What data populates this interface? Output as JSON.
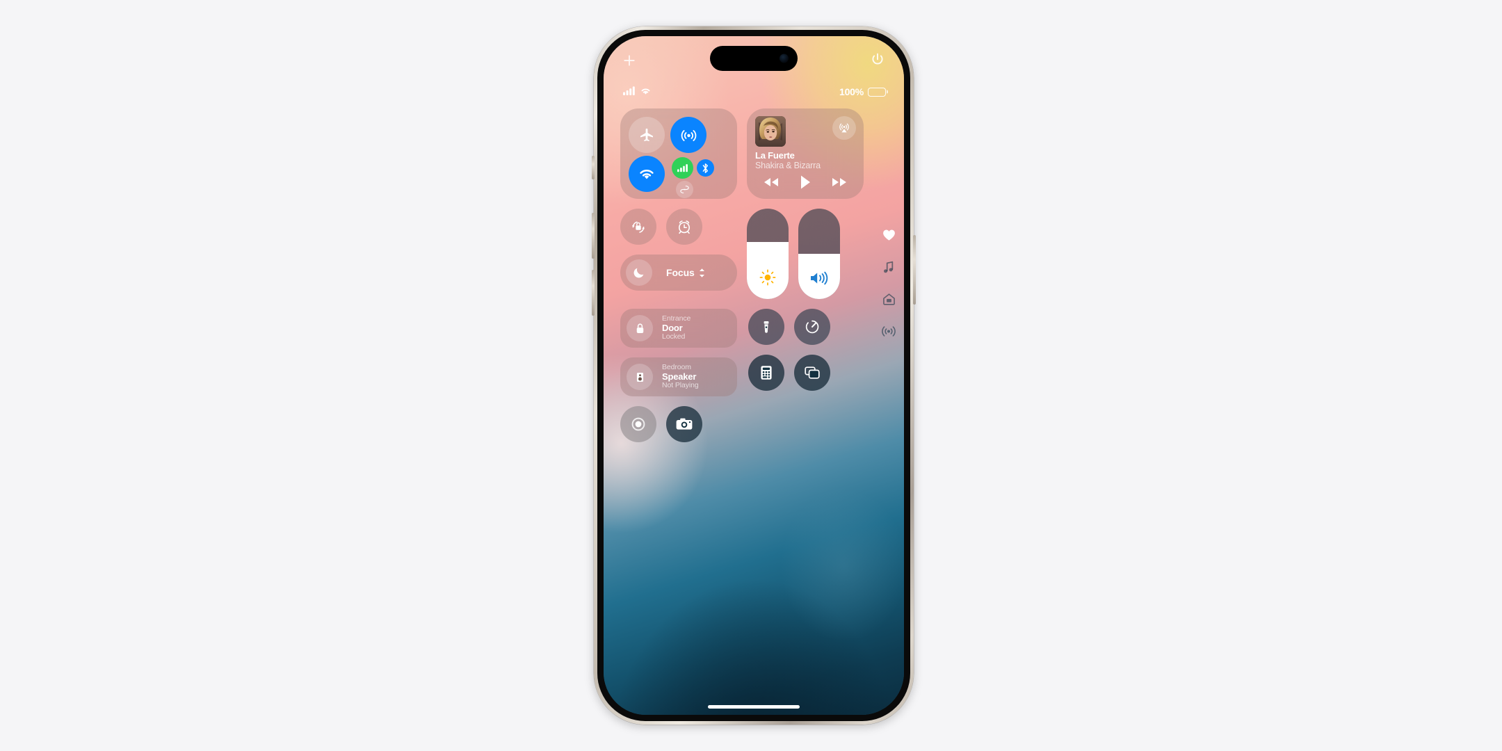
{
  "device": {
    "name": "iPhone",
    "frame": "titanium"
  },
  "statusbar": {
    "signal_icon": "cellular-bars-icon",
    "wifi_icon": "wifi-icon",
    "battery_percent": "100%",
    "battery_icon": "battery-full-icon"
  },
  "top_controls": {
    "add_label": "+",
    "add_name": "plus-icon",
    "power_name": "power-icon"
  },
  "connectivity": {
    "airplane": {
      "label": "Airplane Mode",
      "state": "off",
      "color": "#ffffff38"
    },
    "airdrop": {
      "label": "AirDrop",
      "state": "on",
      "color": "#0a84ff"
    },
    "wifi": {
      "label": "Wi-Fi",
      "state": "on",
      "color": "#0a84ff"
    },
    "cellular": {
      "label": "Cellular Data",
      "state": "on",
      "color": "#30d158"
    },
    "bluetooth": {
      "label": "Bluetooth",
      "state": "on",
      "color": "#0a84ff"
    },
    "hotspot": {
      "label": "Personal Hotspot",
      "state": "off",
      "color": "#ffffff33"
    }
  },
  "now_playing": {
    "title": "La Fuerte",
    "artist": "Shakira & Bizarra",
    "airplay_icon": "airplay-audio-icon",
    "rewind_icon": "rewind-icon",
    "play_icon": "play-icon",
    "forward_icon": "fast-forward-icon"
  },
  "quick_toggles": {
    "rotation_lock": {
      "label": "Rotation Lock",
      "icon": "rotation-lock-icon"
    },
    "alarm": {
      "label": "Alarm",
      "icon": "alarm-clock-icon"
    }
  },
  "focus": {
    "label": "Focus",
    "moon_icon": "moon-icon",
    "chevron_icon": "chevron-up-down-icon"
  },
  "home_accessories": [
    {
      "room": "Entrance",
      "name": "Door",
      "state": "Locked",
      "icon": "lock-icon"
    },
    {
      "room": "Bedroom",
      "name": "Speaker",
      "state": "Not Playing",
      "icon": "speaker-icon"
    }
  ],
  "sliders": {
    "brightness": {
      "label": "Brightness",
      "value": 63,
      "icon": "sun-icon",
      "icon_color": "#ffb300"
    },
    "volume": {
      "label": "Volume",
      "value": 50,
      "icon": "speaker-wave-icon",
      "icon_color": "#1f7fd0"
    }
  },
  "utility_buttons": [
    {
      "label": "Flashlight",
      "icon": "flashlight-icon"
    },
    {
      "label": "Timer",
      "icon": "timer-icon"
    },
    {
      "label": "Calculator",
      "icon": "calculator-icon"
    },
    {
      "label": "Screen Mirroring",
      "icon": "screen-mirroring-icon"
    }
  ],
  "bottom_buttons": [
    {
      "label": "Screen Recording",
      "icon": "screen-record-icon"
    },
    {
      "label": "Camera",
      "icon": "camera-icon"
    }
  ],
  "page_rail": [
    {
      "label": "Favorites",
      "icon": "heart-icon",
      "active": true
    },
    {
      "label": "Media",
      "icon": "music-note-icon",
      "active": false
    },
    {
      "label": "Home",
      "icon": "home-icon",
      "active": false
    },
    {
      "label": "Connectivity",
      "icon": "antenna-icon",
      "active": false
    }
  ],
  "home_indicator": {
    "label": "Home Indicator"
  }
}
